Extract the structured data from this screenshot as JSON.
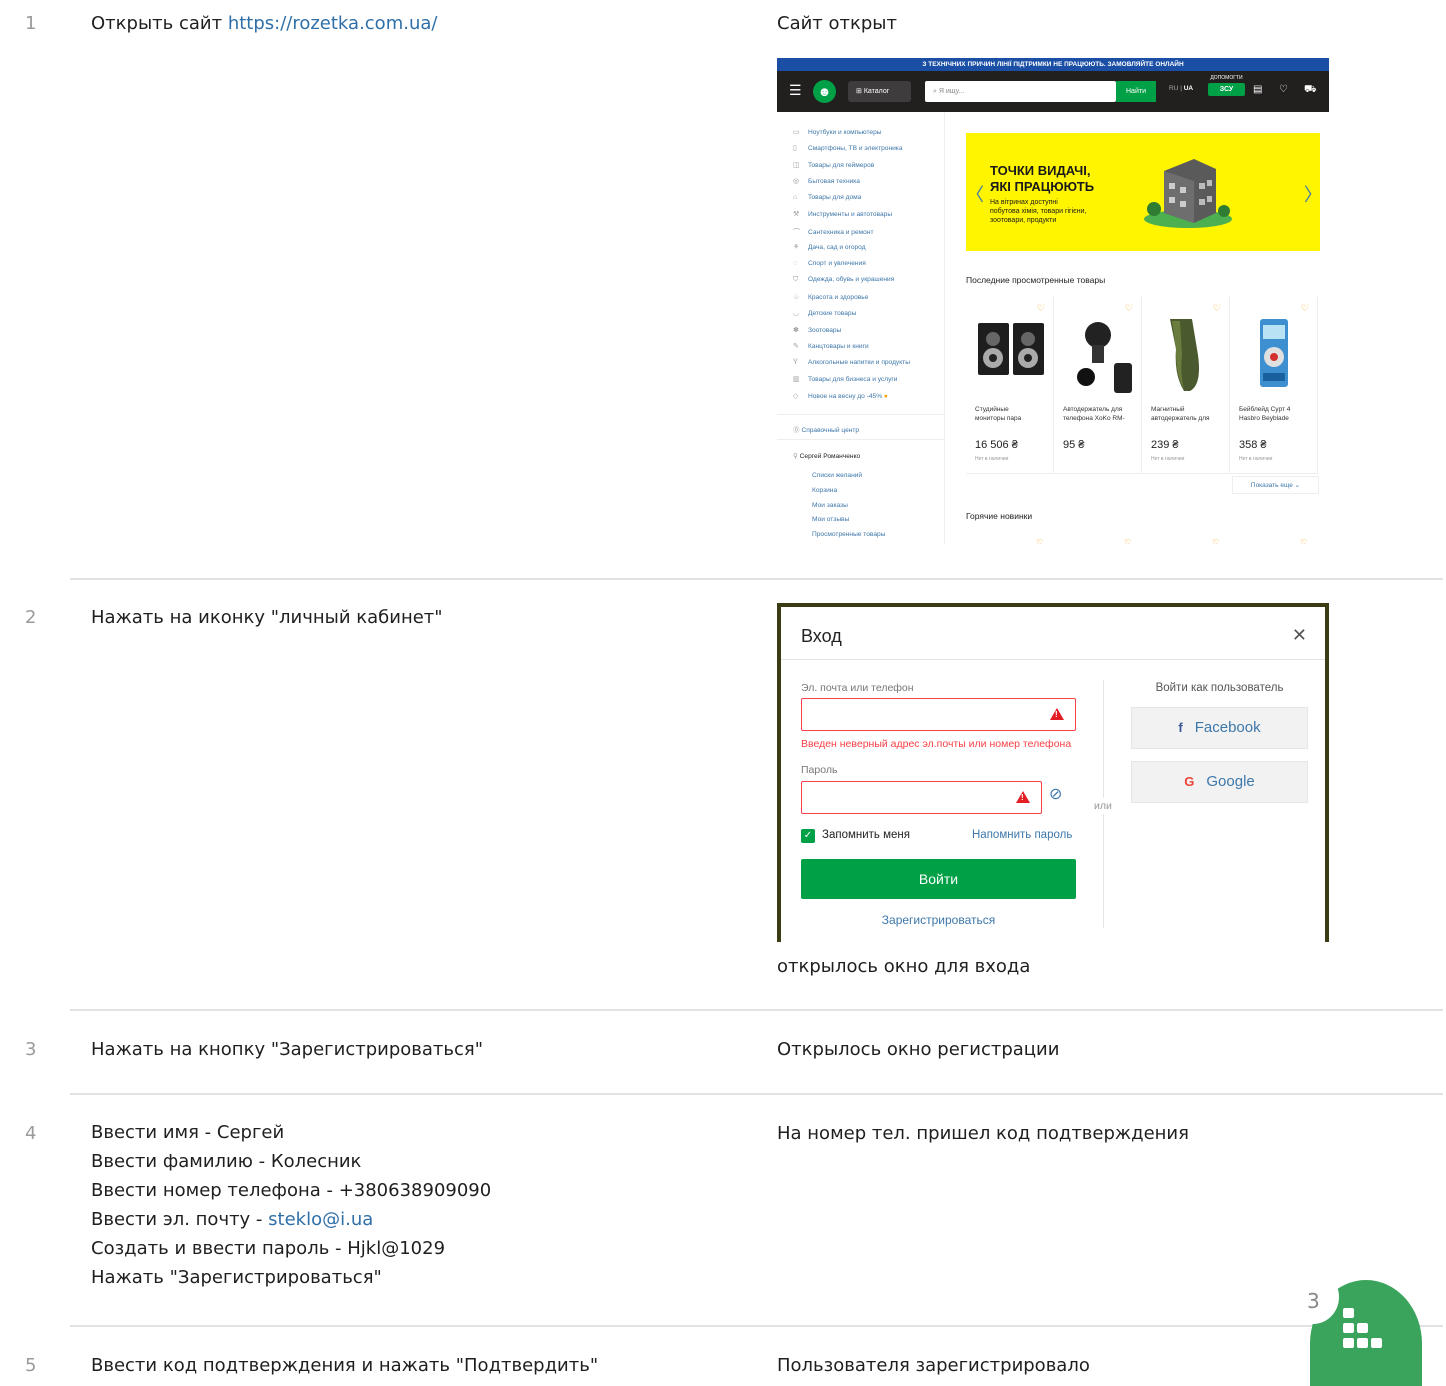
{
  "steps": [
    {
      "num": "1",
      "action_prefix": "Открыть сайт ",
      "action_link": "https://rozetka.com.ua/",
      "result": "Сайт открыт"
    },
    {
      "num": "2",
      "action": "Нажать на иконку \"личный кабинет\"",
      "result": "открылось окно для входа"
    },
    {
      "num": "3",
      "action": "Нажать на кнопку \"Зарегистрироваться\"",
      "result": "Открылось окно регистрации"
    },
    {
      "num": "4",
      "lines": [
        "Ввести имя - Сергей",
        "Ввести фамилию - Колесник",
        "Ввести номер телефона - +380638909090"
      ],
      "email_prefix": "Ввести эл. почту - ",
      "email": "steklo@i.ua",
      "lines2": [
        "Создать и ввести пароль - Hjkl@1029",
        "Нажать \"Зарегистрироваться\""
      ],
      "result": "На номер тел. пришел код подтверждения"
    },
    {
      "num": "5",
      "action": "Ввести код подтверждения и нажать \"Подтвердить\"",
      "result": "Пользователя зарегистрировало"
    }
  ],
  "site": {
    "top_banner": "З ТЕХНІЧНИХ ПРИЧИН ЛІНІЇ ПІДТРИМКИ НЕ ПРАЦЮЮТЬ. ЗАМОВЛЯЙТЕ ОНЛАЙН",
    "catalog_label": "Каталог",
    "search_placeholder": "Я ищу...",
    "find_label": "Найти",
    "lang_ru": "RU",
    "lang_ua": "UA",
    "help_label": "ДОПОМОГТИ",
    "zsu_label": "ЗСУ",
    "categories": [
      "Ноутбуки и компьютеры",
      "Смартфоны, ТВ и электроника",
      "Товары для геймеров",
      "Бытовая техника",
      "Товары для дома",
      "Инструменты и автотовары",
      "Сантехника и ремонт",
      "Дача, сад и огород",
      "Спорт и увлечения",
      "Одежда, обувь и украшения",
      "Красота и здоровье",
      "Детские товары",
      "Зоотовары",
      "Канцтовары и книги",
      "Алкогольные напитки и продукты",
      "Товары для бизнеса и услуги",
      "Новое на весну до -45%"
    ],
    "help_center": "Справочный центр",
    "user_name": "Сергей Романченко",
    "user_links": [
      "Списки желаний",
      "Корзина",
      "Мои заказы",
      "Мои отзывы",
      "Просмотренные товары"
    ],
    "promo_title_1": "ТОЧКИ ВИДАЧІ,",
    "promo_title_2": "ЯКІ ПРАЦЮЮТЬ",
    "promo_text_1": "На вітринах доступні",
    "promo_text_2": "побутова хімія, товари гігієни,",
    "promo_text_3": "зоотовари, продукти",
    "recent_title": "Последние просмотренные товары",
    "products": [
      {
        "name_1": "Студийные",
        "name_2": "мониторы пара",
        "price": "16 506 ₴",
        "stock": "Нет в наличии"
      },
      {
        "name_1": "Автодержатель для",
        "name_2": "телефона XoKo RM-",
        "price": "95 ₴",
        "stock": ""
      },
      {
        "name_1": "Магнитный",
        "name_2": "автодержатель для",
        "price": "239 ₴",
        "stock": "Нет в наличии"
      },
      {
        "name_1": "Бейблейд Сурт 4",
        "name_2": "Hasbro Beyblade",
        "price": "358 ₴",
        "stock": "Нет в наличии"
      }
    ],
    "show_more": "Показать еще",
    "hot_title": "Горячие новинки"
  },
  "login_modal": {
    "title": "Вход",
    "email_label": "Эл. почта или телефон",
    "email_error": "Введен неверный адрес эл.почты или номер телефона",
    "password_label": "Пароль",
    "remember_label": "Запомнить меня",
    "remind_label": "Напомнить пароль",
    "login_button": "Войти",
    "register_link": "Зарегистрироваться",
    "or_label": "или",
    "social_title": "Войти как пользователь",
    "facebook_label": "Facebook",
    "google_label": "Google"
  },
  "page_badge": "3"
}
